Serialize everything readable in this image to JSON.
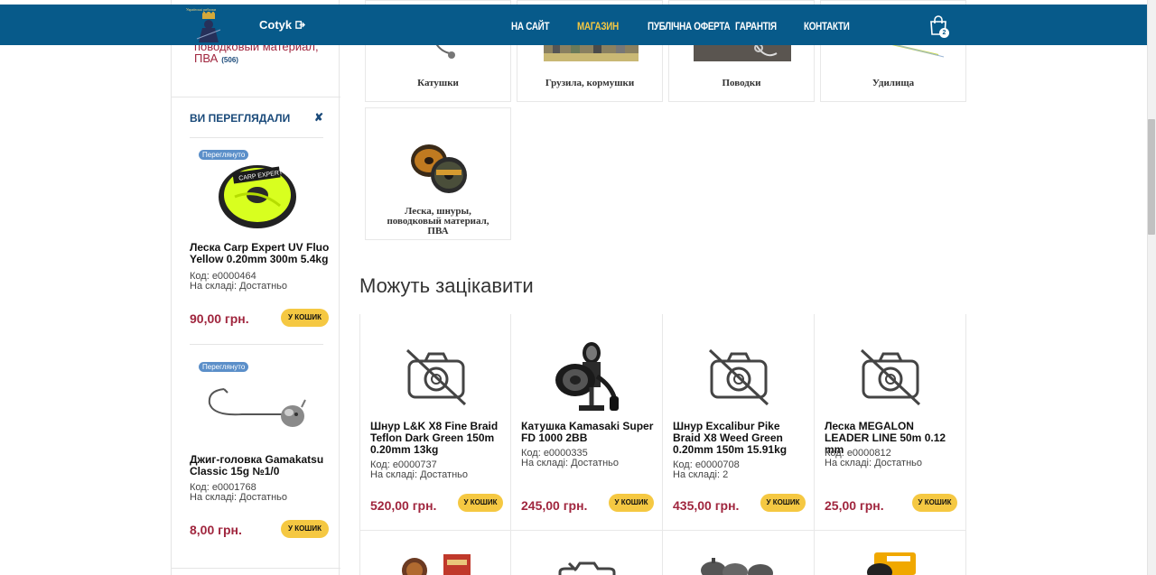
{
  "header": {
    "logo_text": "Українські рибалки",
    "user_name": "Cotyk",
    "nav": [
      {
        "label": "На сайт",
        "active": false
      },
      {
        "label": "Магазин",
        "active": true
      },
      {
        "label": "Публічна оферта",
        "active": false
      },
      {
        "label": "Гарантія",
        "active": false
      },
      {
        "label": "Контакти",
        "active": false
      }
    ],
    "cart_count": "2"
  },
  "sidebar": {
    "category_partial": "поводковый материал, ПВА",
    "category_count": "(506)",
    "viewed_title": "ВИ ПЕРЕГЛЯДАЛИ",
    "viewed_close": "✘",
    "viewed_items": [
      {
        "badge": "Переглянуто",
        "name": "Леска Carp Expert UV Fluo Yellow 0.20mm 300m 5.4kg",
        "code": "Код: е0000464",
        "stock": "На складі: Достатньо",
        "price": "90,00 грн.",
        "cart_label": "У КОШИК"
      },
      {
        "badge": "Переглянуто",
        "name": "Джиг-головка Gamakatsu Classic 15g №1/0",
        "code": "Код: е0001768",
        "stock": "На складі: Достатньо",
        "price": "8,00 грн.",
        "cart_label": "У КОШИК"
      }
    ]
  },
  "categories": [
    {
      "label": "Катушки"
    },
    {
      "label": "Грузила, кормушки"
    },
    {
      "label": "Поводки"
    },
    {
      "label": "Удилища"
    },
    {
      "label": "Леска, шнуры, поводковый материал, ПВА"
    }
  ],
  "section_title": "Можуть зацікавити",
  "products": [
    {
      "name": "Шнур L&K X8 Fine Braid Teflon Dark Green 150m 0.20mm 13kg",
      "code": "Код: е0000737",
      "stock": "На складі: Достатньо",
      "price": "520,00 грн.",
      "cart_label": "У КОШИК",
      "image": "no-photo-icon"
    },
    {
      "name": "Катушка Kamasaki Super FD 1000 2BB",
      "code": "Код: е0000335",
      "stock": "На складі: Достатньо",
      "price": "245,00 грн.",
      "cart_label": "У КОШИК",
      "image": "reel-icon"
    },
    {
      "name": "Шнур Excalibur Pike Braid X8 Weed Green 0.20mm 150m 15.91kg",
      "code": "Код: е0000708",
      "stock": "На складі: 2",
      "price": "435,00 грн.",
      "cart_label": "У КОШИК",
      "image": "no-photo-icon"
    },
    {
      "name": "Леска MEGALON LEADER LINE 50m 0.12 mm",
      "code": "Код: е0000812",
      "stock": "На складі: Достатньо",
      "price": "25,00 грн.",
      "cart_label": "У КОШИК",
      "image": "no-photo-icon"
    }
  ],
  "colors": {
    "header_bg": "#075a8a",
    "accent": "#f5c842",
    "price": "#a0263e",
    "link": "#1a4a7a"
  }
}
